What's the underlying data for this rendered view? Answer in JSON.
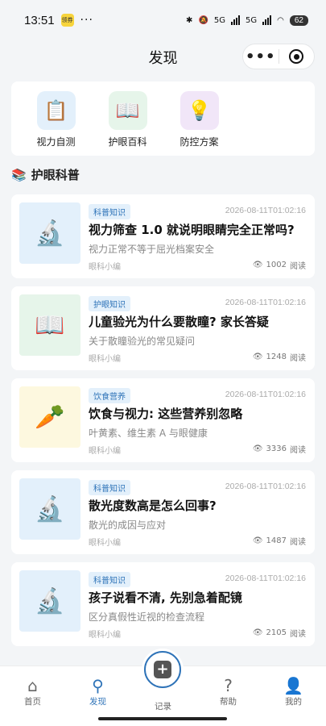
{
  "status_bar": {
    "time": "13:51",
    "app_badge": "领券",
    "dots": "···",
    "network1": "5G",
    "network2": "5G",
    "battery": "62"
  },
  "header": {
    "title": "发现",
    "more": "•••"
  },
  "tools": [
    {
      "label": "视力自测",
      "icon": "📋",
      "bg": "#e3f0fb"
    },
    {
      "label": "护眼百科",
      "icon": "📖",
      "bg": "#e6f5ea"
    },
    {
      "label": "防控方案",
      "icon": "💡",
      "bg": "#f1e6f8"
    }
  ],
  "section": {
    "icon": "📚",
    "title": "护眼科普"
  },
  "articles": [
    {
      "tag": "科普知识",
      "tag_bg": "#e3f0fb",
      "tag_color": "#2e73b8",
      "date": "2026-08-11T01:02:16",
      "title": "视力筛查 1.0 就说明眼睛完全正常吗?",
      "subtitle": "视力正常不等于屈光档案安全",
      "author": "眼科小编",
      "views": "1002",
      "reads_label": "阅读",
      "icon": "🔬",
      "thumb_bg": "#e3f0fb"
    },
    {
      "tag": "护眼知识",
      "tag_bg": "#e3f0fb",
      "tag_color": "#2e73b8",
      "date": "2026-08-11T01:02:16",
      "title": "儿童验光为什么要散瞳? 家长答疑",
      "subtitle": "关于散瞳验光的常见疑问",
      "author": "眼科小编",
      "views": "1248",
      "reads_label": "阅读",
      "icon": "📖",
      "thumb_bg": "#e6f5ea"
    },
    {
      "tag": "饮食营养",
      "tag_bg": "#e3f0fb",
      "tag_color": "#2e73b8",
      "date": "2026-08-11T01:02:16",
      "title": "饮食与视力: 这些营养别忽略",
      "subtitle": "叶黄素、维生素 A 与眼健康",
      "author": "眼科小编",
      "views": "3336",
      "reads_label": "阅读",
      "icon": "🥕",
      "thumb_bg": "#fdf8df"
    },
    {
      "tag": "科普知识",
      "tag_bg": "#e3f0fb",
      "tag_color": "#2e73b8",
      "date": "2026-08-11T01:02:16",
      "title": "散光度数高是怎么回事?",
      "subtitle": "散光的成因与应对",
      "author": "眼科小编",
      "views": "1487",
      "reads_label": "阅读",
      "icon": "🔬",
      "thumb_bg": "#e3f0fb"
    },
    {
      "tag": "科普知识",
      "tag_bg": "#e3f0fb",
      "tag_color": "#2e73b8",
      "date": "2026-08-11T01:02:16",
      "title": "孩子说看不清, 先别急着配镜",
      "subtitle": "区分真假性近视的检查流程",
      "author": "眼科小编",
      "views": "2105",
      "reads_label": "阅读",
      "icon": "🔬",
      "thumb_bg": "#e3f0fb"
    }
  ],
  "tabbar": {
    "home": {
      "label": "首页",
      "icon": "⌂"
    },
    "discover": {
      "label": "发现",
      "icon": "⚲"
    },
    "record": {
      "label": "记录",
      "icon": "+"
    },
    "help": {
      "label": "帮助",
      "icon": "?"
    },
    "mine": {
      "label": "我的",
      "icon": "👤"
    }
  },
  "colors": {
    "accent": "#2e73b8",
    "background": "#f3f5f7"
  }
}
